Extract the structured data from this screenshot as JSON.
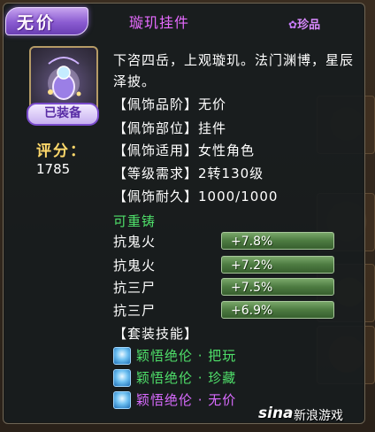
{
  "tooltip": {
    "grade_tag": "无价",
    "item_name": "璇玑挂件",
    "rarity": "珍品",
    "rarity_deco": "✿",
    "equipped": "已装备",
    "score_label": "评分：",
    "score_value": "1785",
    "description": "下咨四岳，上观璇玑。法门渊博，星辰泽披。",
    "attributes": [
      "【佩饰品阶】无价",
      "【佩饰部位】挂件",
      "【佩饰适用】女性角色",
      "【等级需求】2转130级",
      "【佩饰耐久】1000/1000"
    ],
    "recast": "可重铸",
    "stats": [
      {
        "name": "抗鬼火",
        "value": "+7.8%"
      },
      {
        "name": "抗鬼火",
        "value": "+7.2%"
      },
      {
        "name": "抗三尸",
        "value": "+7.5%"
      },
      {
        "name": "抗三尸",
        "value": "+6.9%"
      }
    ],
    "set_title": "【套装技能】",
    "skills": [
      {
        "label": "颖悟绝伦 · 把玩",
        "active": true
      },
      {
        "label": "颖悟绝伦 · 珍藏",
        "active": true
      },
      {
        "label": "颖悟绝伦 · 无价",
        "active": false
      }
    ]
  },
  "watermark": {
    "brand": "sina",
    "text": "新浪游戏"
  },
  "colors": {
    "active": "#4fe06a",
    "inactive": "#d96bff",
    "name": "#e66bff",
    "score": "#ffd96b"
  }
}
